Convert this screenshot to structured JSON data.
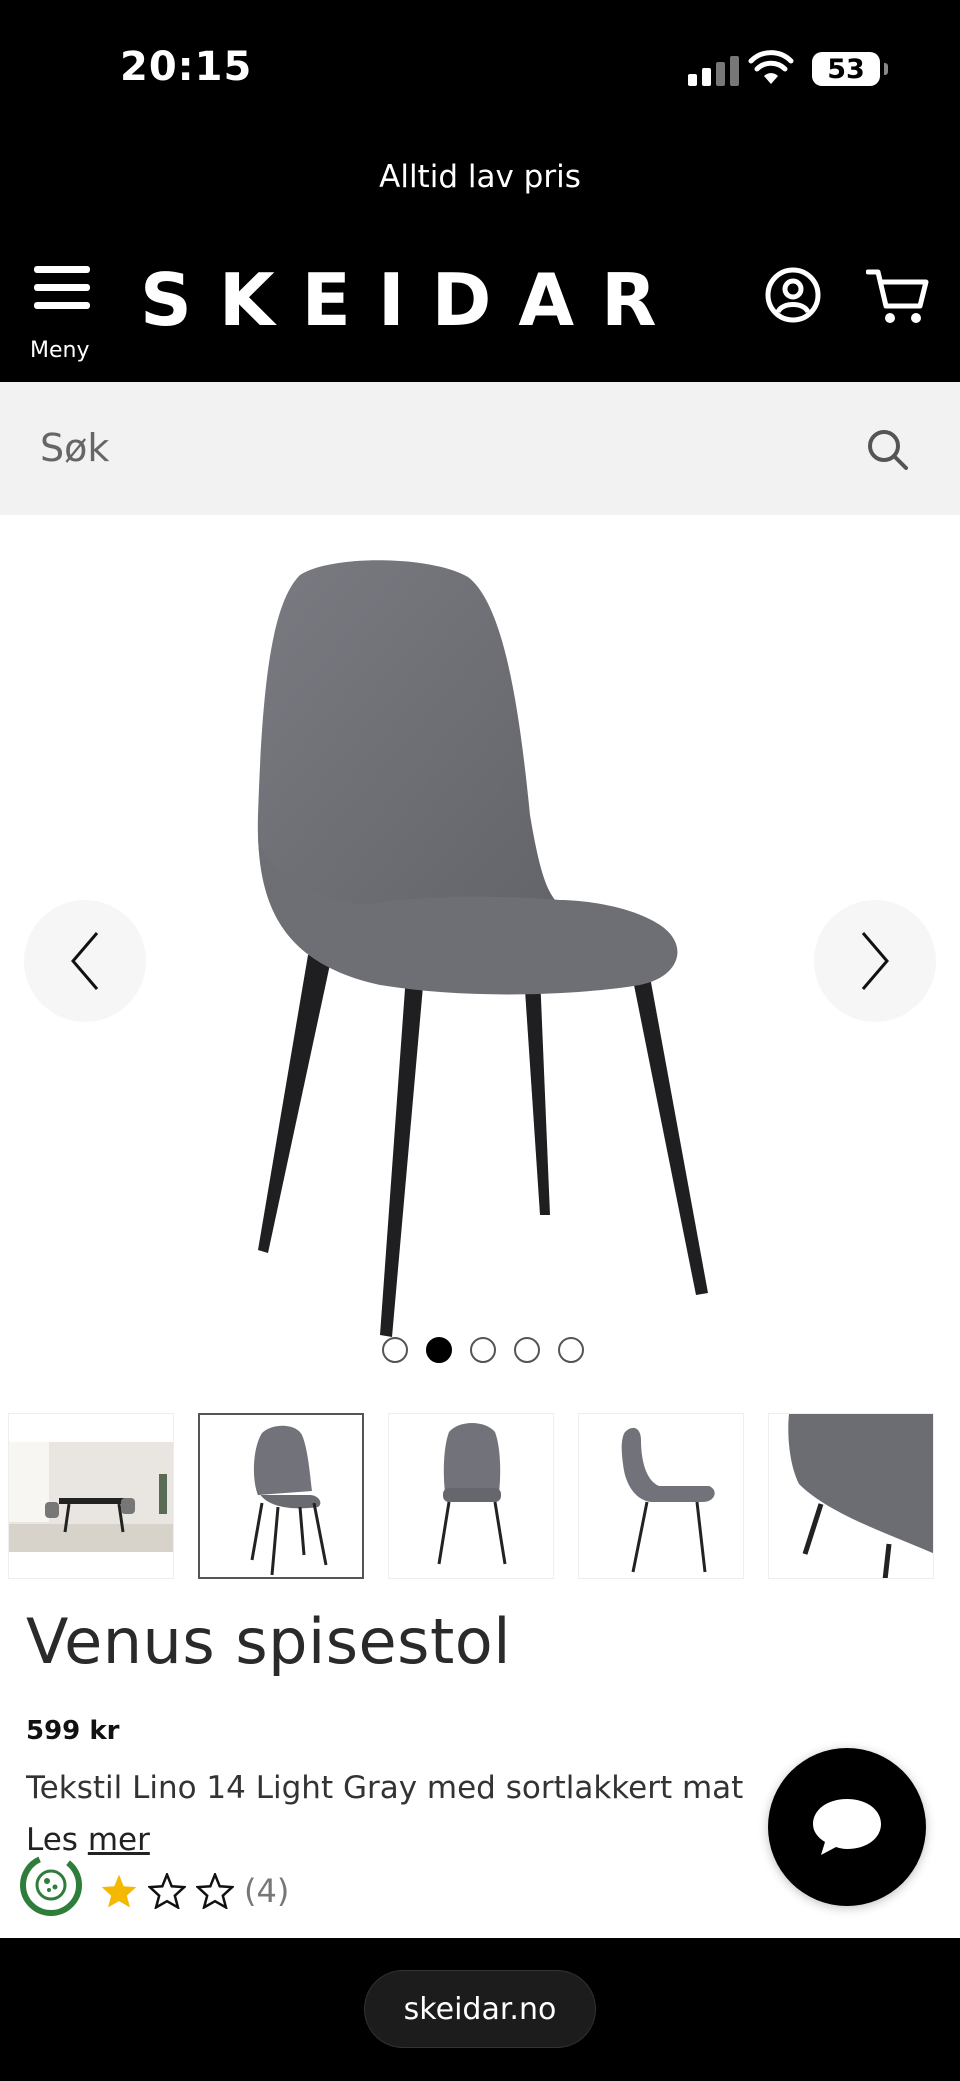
{
  "status_bar": {
    "time": "20:15",
    "battery": "53"
  },
  "promo": {
    "text": "Alltid lav pris"
  },
  "header": {
    "logo": "SKEIDAR",
    "menu_label": "Meny"
  },
  "search": {
    "placeholder": "Søk"
  },
  "gallery": {
    "image_count": 5,
    "active_index": 1
  },
  "product": {
    "title": "Venus spisestol",
    "price": "599 kr",
    "description": "Tekstil Lino 14 Light Gray med sortlakkert mat",
    "read_more_prefix": "Les ",
    "read_more_link": "mer",
    "rating": 2,
    "rating_max": 5,
    "review_count": "(4)"
  },
  "browser": {
    "url": "skeidar.no"
  },
  "colors": {
    "black": "#000000",
    "star": "#f5b800",
    "chair": "#6f7077"
  }
}
